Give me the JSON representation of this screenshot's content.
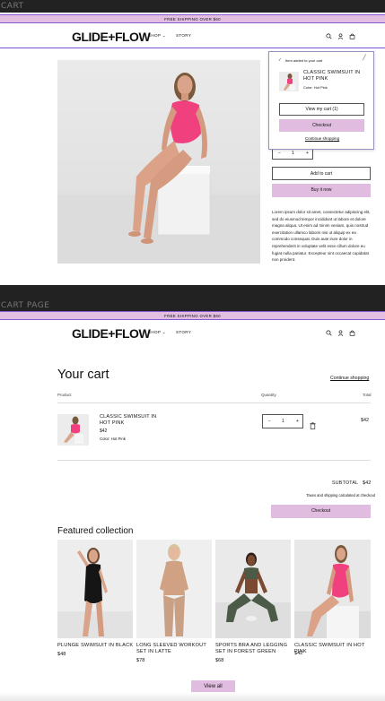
{
  "section1": {
    "label": "CART",
    "announcement": "FREE SHIPPING OVER $60",
    "header": {
      "logo": "GLIDE+FLOW",
      "nav_shop": "SHOP ⌄",
      "nav_story": "STORY"
    },
    "product": {
      "qty_minus": "−",
      "qty_value": "1",
      "qty_plus": "+",
      "add_to_cart": "Add to cart",
      "buy_now": "Buy it now",
      "description": "Lorem ipsum dolor sit amet, consectetur adipiscing elit, sed do eiusmod tempor incididunt ut labore et dolore magna aliqua. Ut enim ad minim veniam, quis nostrud exercitation ullamco laboris nisi ut aliquip ex ea commodo consequat. Duis aute irure dolor in reprehenderit in voluptate velit esse cillum dolore eu fugiat nulla pariatur. Excepteur sint occaecat cupidatat non proident."
    },
    "popup": {
      "added_message": "Item added to your cart",
      "check_glyph": "✓",
      "close_glyph": "╱",
      "item_title": "CLASSIC SWIMSUIT IN HOT PINK",
      "item_color": "Color: Hot Pink",
      "view_cart": "View my cart (1)",
      "checkout": "Checkout",
      "continue": "Continue shopping"
    }
  },
  "section2": {
    "label": "CART PAGE",
    "announcement": "FREE SHIPPING OVER $60",
    "header": {
      "logo": "GLIDE+FLOW",
      "nav_shop": "SHOP ⌄",
      "nav_story": "STORY"
    },
    "cart": {
      "title": "Your cart",
      "continue_shopping": "Continue shopping",
      "col_product": "Product",
      "col_quantity": "Quantity",
      "col_total": "Total",
      "item": {
        "title": "CLASSIC SWIMSUIT IN HOT PINK",
        "price": "$42",
        "color": "Color: Hot Pink",
        "qty_minus": "−",
        "qty_value": "1",
        "qty_plus": "+",
        "line_total": "$42"
      },
      "subtotal_label": "SUBTOTAL",
      "subtotal_value": "$42",
      "taxes_note": "Taxes and shipping calculated at checkout",
      "checkout": "Checkout"
    },
    "featured": {
      "title": "Featured collection",
      "products": [
        {
          "name": "PLUNGE SWIMSUIT IN BLACK",
          "price": "$48"
        },
        {
          "name": "LONG SLEEVED WORKOUT SET IN LATTE",
          "price": "$78"
        },
        {
          "name": "SPORTS BRA AND LEGGING SET IN FOREST GREEN",
          "price": "$68"
        },
        {
          "name": "CLASSIC SWIMSUIT IN HOT PINK",
          "price": "$42"
        }
      ],
      "view_all": "View all"
    }
  },
  "colors": {
    "accent_pink": "#e0bde0",
    "border_purple": "#7d54d9",
    "dark_band": "#222222",
    "swimsuit_pink": "#f0407e"
  }
}
